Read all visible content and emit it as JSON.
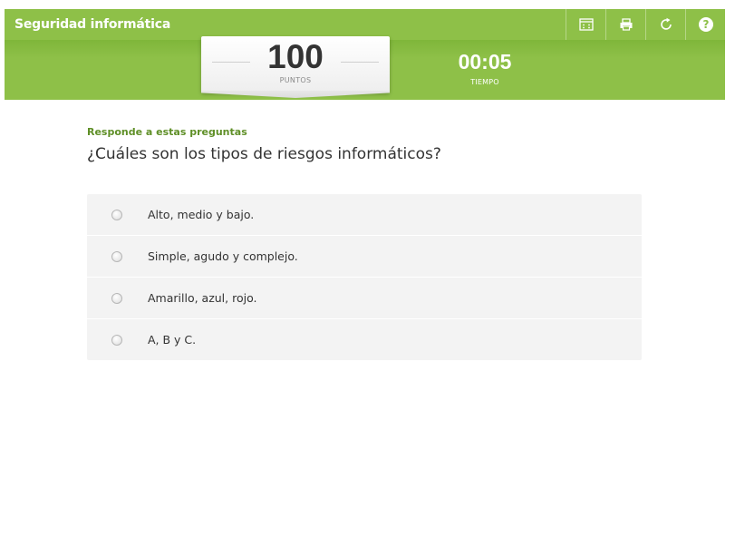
{
  "app": {
    "title": "Seguridad informática"
  },
  "toolbar": {
    "buttons": [
      {
        "icon": "fullscreen-icon"
      },
      {
        "icon": "print-icon"
      },
      {
        "icon": "restart-icon"
      },
      {
        "icon": "help-icon"
      }
    ]
  },
  "score": {
    "value": "100",
    "label": "PUNTOS"
  },
  "timer": {
    "value": "00:05",
    "label": "TIEMPO"
  },
  "quiz": {
    "instruction": "Responde a estas preguntas",
    "question": "¿Cuáles son los tipos de riesgos informáticos?",
    "answers": [
      {
        "label": "Alto, medio y bajo.",
        "selected": false
      },
      {
        "label": "Simple, agudo y complejo.",
        "selected": false
      },
      {
        "label": "Amarillo, azul, rojo.",
        "selected": false
      },
      {
        "label": "A, B y C.",
        "selected": false
      }
    ]
  },
  "colors": {
    "header_green": "#8ec048",
    "instruction_green": "#5f8f27",
    "answer_bg": "#f3f3f3"
  }
}
